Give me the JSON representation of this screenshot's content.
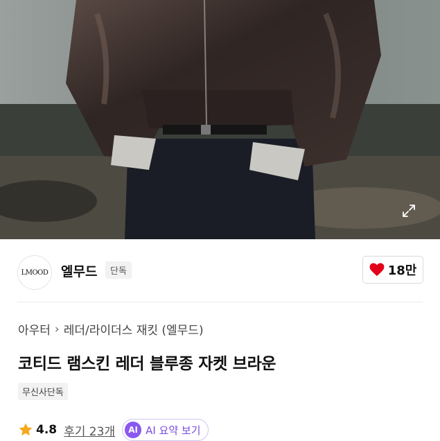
{
  "hero": {
    "image_alt": "",
    "expand_icon": "expand-icon"
  },
  "brand": {
    "logo_text": "LMOOD",
    "name": "엘무드",
    "tag": "단독",
    "like_count": "18만",
    "like_icon": "heart-icon",
    "like_color": "#e2001a"
  },
  "product": {
    "breadcrumb": [
      "아우터",
      "레더/라이더스 재킷 (엘무드)"
    ],
    "title": "코티드 램스킨 레더 블루종 자켓 브라운",
    "badge": "무신사단독",
    "rating": "4.8",
    "reviews": "후기 23개",
    "ai_badge": "AI",
    "ai_label": "AI 요약 보기",
    "star_color": "#f6a81c",
    "ai_color": "#8a58f0"
  }
}
